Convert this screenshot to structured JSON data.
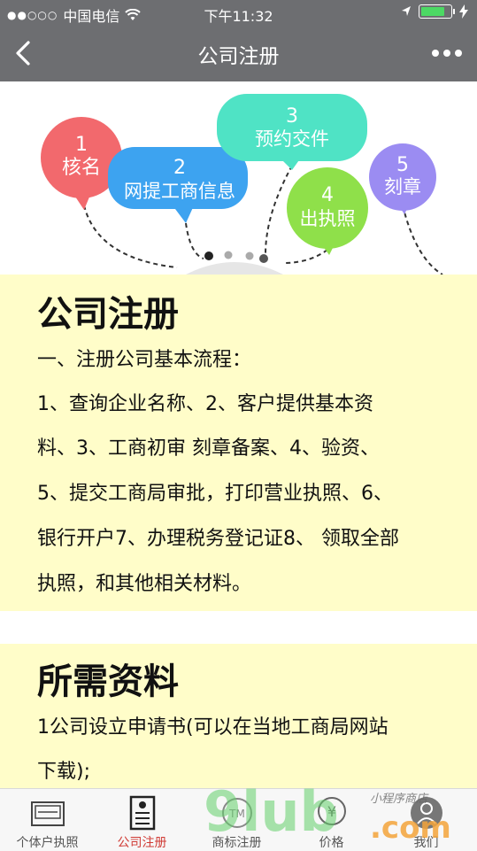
{
  "status_bar": {
    "signal": "●●○○○",
    "carrier": "中国电信",
    "time": "下午11:32"
  },
  "nav": {
    "title": "公司注册"
  },
  "illustration": {
    "bubbles": [
      {
        "number": "1",
        "label": "核名",
        "color": "#f2696d"
      },
      {
        "number": "2",
        "label": "网提工商信息",
        "color": "#3da3f0"
      },
      {
        "number": "3",
        "label": "预约交件",
        "color": "#4fe3c5"
      },
      {
        "number": "4",
        "label": "出执照",
        "color": "#8fe04a"
      },
      {
        "number": "5",
        "label": "刻章",
        "color": "#9b8cf2"
      }
    ]
  },
  "section1": {
    "title": "公司注册",
    "lines": [
      "一、注册公司基本流程：",
      "1、查询企业名称、2、客户提供基本资",
      "料、3、工商初审 刻章备案、4、验资、",
      "5、提交工商局审批，打印营业执照、6、",
      "银行开户7、办理税务登记证8、 领取全部",
      "执照，和其他相关材料。"
    ]
  },
  "section2": {
    "title": "所需资料",
    "lines": [
      "1公司设立申请书(可以在当地工商局网站",
      "下载);"
    ]
  },
  "tabs": [
    {
      "label": "个体户执照",
      "icon": "shop-icon",
      "active": false
    },
    {
      "label": "公司注册",
      "icon": "document-icon",
      "active": true
    },
    {
      "label": "商标注册",
      "icon": "trademark-icon",
      "active": false
    },
    {
      "label": "价格",
      "icon": "price-icon",
      "active": false
    },
    {
      "label": "我们",
      "icon": "user-icon",
      "active": false
    }
  ],
  "watermark": {
    "text": "9lub",
    "suffix": ".com",
    "handwriting": "小程序商店"
  }
}
